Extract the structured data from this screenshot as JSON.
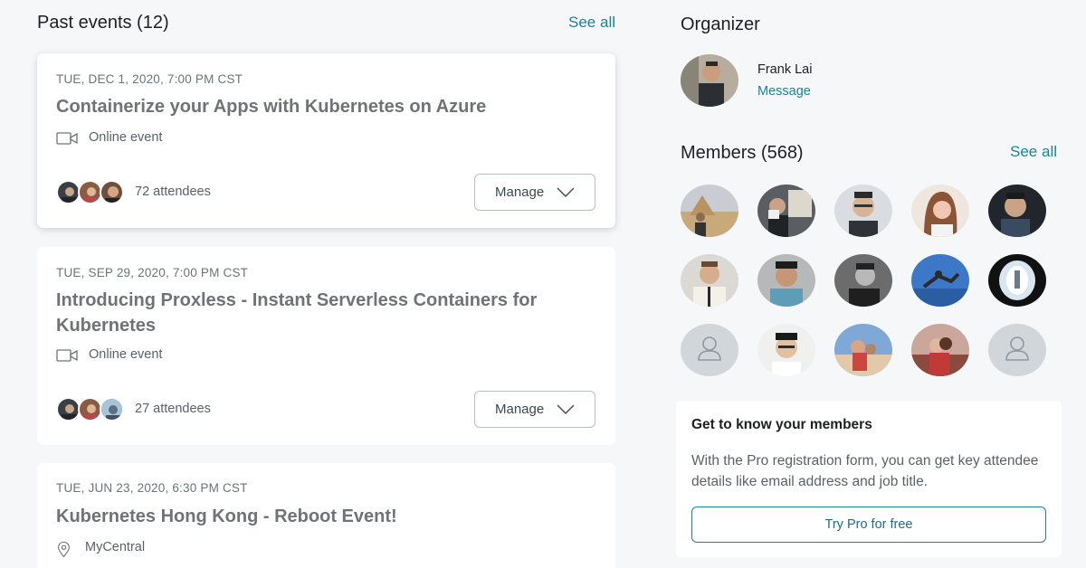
{
  "past_events": {
    "title": "Past events (12)",
    "see_all": "See all",
    "events": [
      {
        "date": "TUE, DEC 1, 2020, 7:00 PM CST",
        "title": "Containerize your Apps with Kubernetes on Azure",
        "location": "Online event",
        "location_icon": "video-camera-icon",
        "attendees": "72 attendees",
        "manage_label": "Manage"
      },
      {
        "date": "TUE, SEP 29, 2020, 7:00 PM CST",
        "title": "Introducing Proxless - Instant Serverless Containers for Kubernetes",
        "location": "Online event",
        "location_icon": "video-camera-icon",
        "attendees": "27 attendees",
        "manage_label": "Manage"
      },
      {
        "date": "TUE, JUN 23, 2020, 6:30 PM CST",
        "title": "Kubernetes Hong Kong - Reboot Event!",
        "location": "MyCentral",
        "location_icon": "map-pin-icon"
      }
    ]
  },
  "organizer": {
    "title": "Organizer",
    "name": "Frank Lai",
    "message": "Message"
  },
  "members": {
    "title": "Members (568)",
    "see_all": "See all"
  },
  "pro_card": {
    "title": "Get to know your members",
    "body": "With the Pro registration form, you can get key attendee details like email address and job title.",
    "button": "Try Pro for free"
  },
  "colors": {
    "link": "#1a8299",
    "background": "#f6f7f8",
    "card": "#ffffff"
  }
}
